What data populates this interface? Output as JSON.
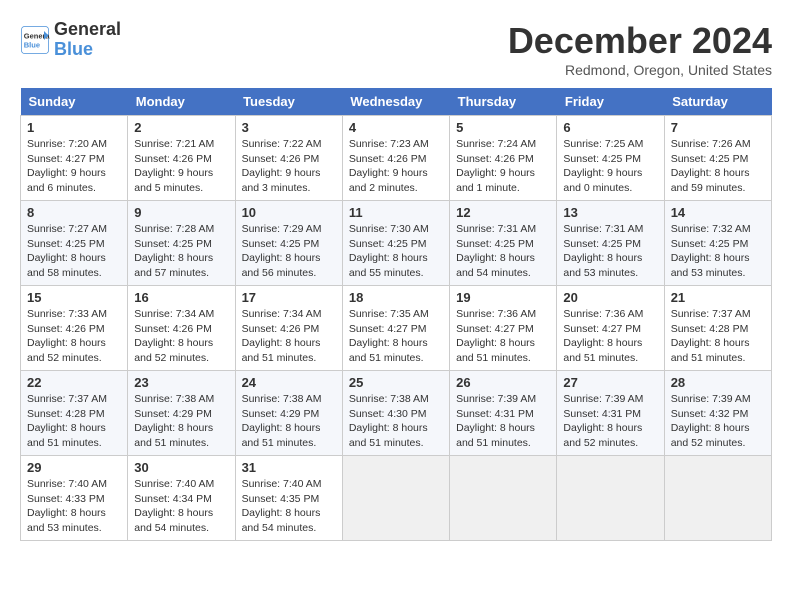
{
  "logo": {
    "text_general": "General",
    "text_blue": "Blue"
  },
  "title": "December 2024",
  "location": "Redmond, Oregon, United States",
  "weekdays": [
    "Sunday",
    "Monday",
    "Tuesday",
    "Wednesday",
    "Thursday",
    "Friday",
    "Saturday"
  ],
  "weeks": [
    [
      {
        "day": "1",
        "sunrise": "7:20 AM",
        "sunset": "4:27 PM",
        "daylight": "9 hours and 6 minutes."
      },
      {
        "day": "2",
        "sunrise": "7:21 AM",
        "sunset": "4:26 PM",
        "daylight": "9 hours and 5 minutes."
      },
      {
        "day": "3",
        "sunrise": "7:22 AM",
        "sunset": "4:26 PM",
        "daylight": "9 hours and 3 minutes."
      },
      {
        "day": "4",
        "sunrise": "7:23 AM",
        "sunset": "4:26 PM",
        "daylight": "9 hours and 2 minutes."
      },
      {
        "day": "5",
        "sunrise": "7:24 AM",
        "sunset": "4:26 PM",
        "daylight": "9 hours and 1 minute."
      },
      {
        "day": "6",
        "sunrise": "7:25 AM",
        "sunset": "4:25 PM",
        "daylight": "9 hours and 0 minutes."
      },
      {
        "day": "7",
        "sunrise": "7:26 AM",
        "sunset": "4:25 PM",
        "daylight": "8 hours and 59 minutes."
      }
    ],
    [
      {
        "day": "8",
        "sunrise": "7:27 AM",
        "sunset": "4:25 PM",
        "daylight": "8 hours and 58 minutes."
      },
      {
        "day": "9",
        "sunrise": "7:28 AM",
        "sunset": "4:25 PM",
        "daylight": "8 hours and 57 minutes."
      },
      {
        "day": "10",
        "sunrise": "7:29 AM",
        "sunset": "4:25 PM",
        "daylight": "8 hours and 56 minutes."
      },
      {
        "day": "11",
        "sunrise": "7:30 AM",
        "sunset": "4:25 PM",
        "daylight": "8 hours and 55 minutes."
      },
      {
        "day": "12",
        "sunrise": "7:31 AM",
        "sunset": "4:25 PM",
        "daylight": "8 hours and 54 minutes."
      },
      {
        "day": "13",
        "sunrise": "7:31 AM",
        "sunset": "4:25 PM",
        "daylight": "8 hours and 53 minutes."
      },
      {
        "day": "14",
        "sunrise": "7:32 AM",
        "sunset": "4:25 PM",
        "daylight": "8 hours and 53 minutes."
      }
    ],
    [
      {
        "day": "15",
        "sunrise": "7:33 AM",
        "sunset": "4:26 PM",
        "daylight": "8 hours and 52 minutes."
      },
      {
        "day": "16",
        "sunrise": "7:34 AM",
        "sunset": "4:26 PM",
        "daylight": "8 hours and 52 minutes."
      },
      {
        "day": "17",
        "sunrise": "7:34 AM",
        "sunset": "4:26 PM",
        "daylight": "8 hours and 51 minutes."
      },
      {
        "day": "18",
        "sunrise": "7:35 AM",
        "sunset": "4:27 PM",
        "daylight": "8 hours and 51 minutes."
      },
      {
        "day": "19",
        "sunrise": "7:36 AM",
        "sunset": "4:27 PM",
        "daylight": "8 hours and 51 minutes."
      },
      {
        "day": "20",
        "sunrise": "7:36 AM",
        "sunset": "4:27 PM",
        "daylight": "8 hours and 51 minutes."
      },
      {
        "day": "21",
        "sunrise": "7:37 AM",
        "sunset": "4:28 PM",
        "daylight": "8 hours and 51 minutes."
      }
    ],
    [
      {
        "day": "22",
        "sunrise": "7:37 AM",
        "sunset": "4:28 PM",
        "daylight": "8 hours and 51 minutes."
      },
      {
        "day": "23",
        "sunrise": "7:38 AM",
        "sunset": "4:29 PM",
        "daylight": "8 hours and 51 minutes."
      },
      {
        "day": "24",
        "sunrise": "7:38 AM",
        "sunset": "4:29 PM",
        "daylight": "8 hours and 51 minutes."
      },
      {
        "day": "25",
        "sunrise": "7:38 AM",
        "sunset": "4:30 PM",
        "daylight": "8 hours and 51 minutes."
      },
      {
        "day": "26",
        "sunrise": "7:39 AM",
        "sunset": "4:31 PM",
        "daylight": "8 hours and 51 minutes."
      },
      {
        "day": "27",
        "sunrise": "7:39 AM",
        "sunset": "4:31 PM",
        "daylight": "8 hours and 52 minutes."
      },
      {
        "day": "28",
        "sunrise": "7:39 AM",
        "sunset": "4:32 PM",
        "daylight": "8 hours and 52 minutes."
      }
    ],
    [
      {
        "day": "29",
        "sunrise": "7:40 AM",
        "sunset": "4:33 PM",
        "daylight": "8 hours and 53 minutes."
      },
      {
        "day": "30",
        "sunrise": "7:40 AM",
        "sunset": "4:34 PM",
        "daylight": "8 hours and 54 minutes."
      },
      {
        "day": "31",
        "sunrise": "7:40 AM",
        "sunset": "4:35 PM",
        "daylight": "8 hours and 54 minutes."
      },
      null,
      null,
      null,
      null
    ]
  ]
}
